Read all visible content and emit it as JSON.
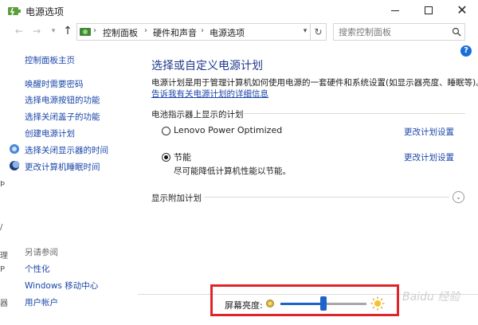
{
  "window": {
    "title": "电源选项"
  },
  "address_bar": {
    "crumbs": [
      "控制面板",
      "硬件和声音",
      "电源选项"
    ],
    "search_placeholder": "搜索控制面板"
  },
  "left_panel": {
    "home": "控制面板主页",
    "links": [
      "唤醒时需要密码",
      "选择电源按钮的功能",
      "选择关闭盖子的功能",
      "创建电源计划",
      "选择关闭显示器的时间",
      "更改计算机睡眠时间"
    ],
    "see_also_heading": "另请参阅",
    "see_also": [
      "个性化",
      "Windows 移动中心",
      "用户帐户"
    ]
  },
  "main": {
    "title": "选择或自定义电源计划",
    "description": "电源计划是用于管理计算机如何使用电源的一套硬件和系统设置(如显示器亮度、睡眠等)。",
    "details_link": "告诉我有关电源计划的详细信息",
    "section_battery": "电池指示器上显示的计划",
    "plans": [
      {
        "name": "Lenovo Power Optimized",
        "selected": false,
        "link": "更改计划设置"
      },
      {
        "name": "节能",
        "selected": true,
        "subtitle": "尽可能降低计算机性能以节能。",
        "link": "更改计划设置"
      }
    ],
    "section_additional": "显示附加计划"
  },
  "bottom": {
    "brightness_label": "屏幕亮度:",
    "brightness_level": 0.5,
    "watermark": "Baidu 经验"
  },
  "colors": {
    "link": "#1a46a8",
    "title": "#1e3a8a",
    "highlight": "#e0252a",
    "slider": "#1e64c8"
  }
}
